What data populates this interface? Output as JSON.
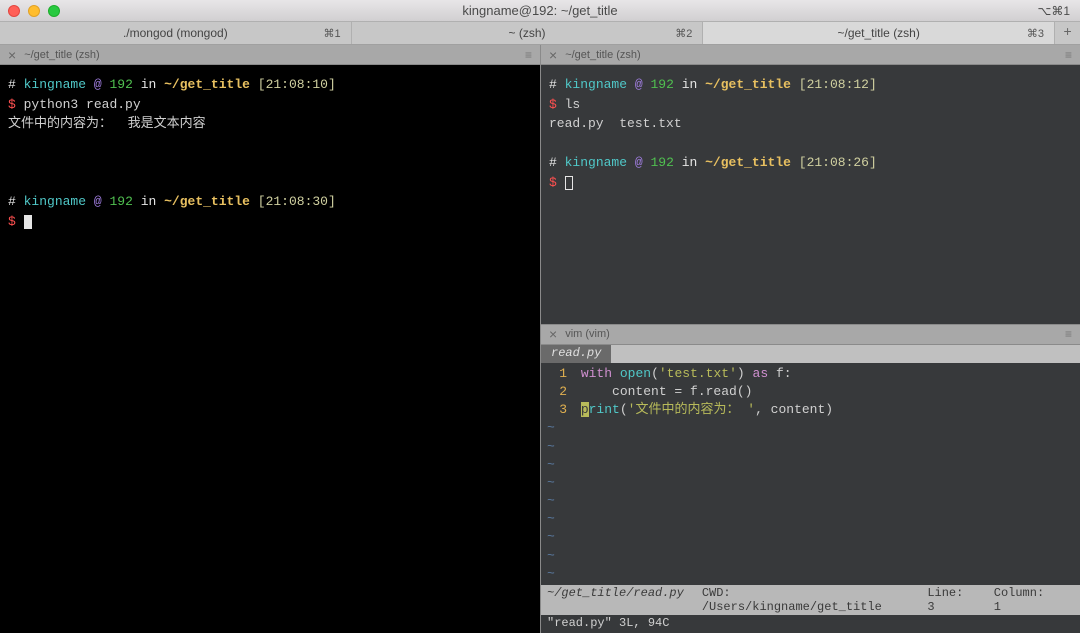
{
  "window": {
    "title": "kingname@192: ~/get_title",
    "right_indicator": "⌥⌘1"
  },
  "tabs": [
    {
      "label": "./mongod (mongod)",
      "shortcut": "⌘1",
      "active": false
    },
    {
      "label": "~ (zsh)",
      "shortcut": "⌘2",
      "active": false
    },
    {
      "label": "~/get_title (zsh)",
      "shortcut": "⌘3",
      "active": true
    }
  ],
  "plus": "+",
  "left": {
    "header": "~/get_title (zsh)",
    "prompt1": {
      "hash": "#",
      "user": "kingname",
      "at": "@",
      "host": "192",
      "inw": "in",
      "path": "~/get_title",
      "time": "[21:08:10]"
    },
    "line1": {
      "dollar": "$",
      "cmd": "python3 read.py"
    },
    "output1": "文件中的内容为：  我是文本内容",
    "prompt2": {
      "hash": "#",
      "user": "kingname",
      "at": "@",
      "host": "192",
      "inw": "in",
      "path": "~/get_title",
      "time": "[21:08:30]"
    },
    "dollar2": "$"
  },
  "right_top": {
    "header": "~/get_title (zsh)",
    "prompt1": {
      "hash": "#",
      "user": "kingname",
      "at": "@",
      "host": "192",
      "inw": "in",
      "path": "~/get_title",
      "time": "[21:08:12]"
    },
    "line1": {
      "dollar": "$",
      "cmd": "ls"
    },
    "output1": "read.py  test.txt",
    "prompt2": {
      "hash": "#",
      "user": "kingname",
      "at": "@",
      "host": "192",
      "inw": "in",
      "path": "~/get_title",
      "time": "[21:08:26]"
    },
    "dollar2": "$"
  },
  "vim": {
    "header": "vim (vim)",
    "tab": "read.py",
    "lines": {
      "l1n": "1",
      "l1a": "with",
      "l1b": "open",
      "l1c": "(",
      "l1d": "'test.txt'",
      "l1e": ")",
      "l1f": "as",
      "l1g": "f:",
      "l2n": "2",
      "l2a": "    content = f.read()",
      "l3n": "3",
      "l3cur": "p",
      "l3a": "rint",
      "l3b": "(",
      "l3c": "'文件中的内容为： '",
      "l3d": ", content)"
    },
    "tilde": "~",
    "status": {
      "path": "~/get_title/read.py",
      "cwd": "CWD: /Users/kingname/get_title",
      "line": "Line: 3",
      "col": "Column: 1"
    },
    "cmdline": "\"read.py\" 3L, 94C"
  }
}
